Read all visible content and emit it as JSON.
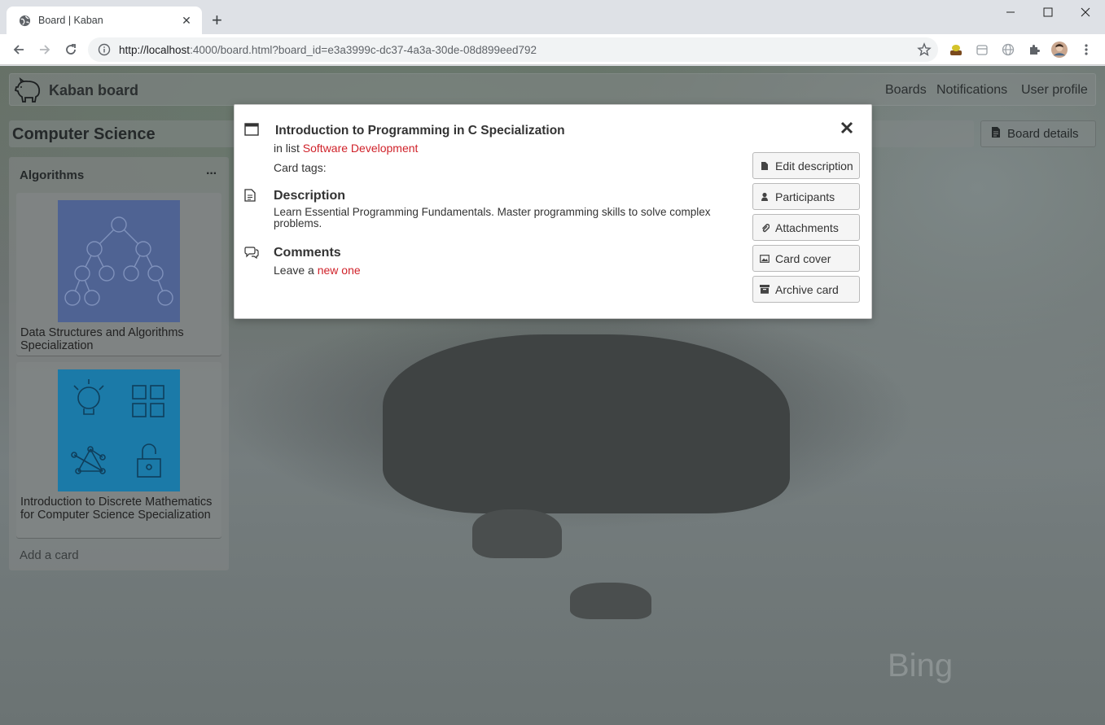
{
  "browser": {
    "tab_title": "Board | Kaban",
    "tab_close": "✕",
    "new_tab": "+",
    "url_host": "http://localhost",
    "url_rest": ":4000/board.html?board_id=e3a3999c-dc37-4a3a-30de-08d899eed792"
  },
  "app": {
    "brand": "Kaban board",
    "nav": [
      "Boards",
      "Notifications",
      "User profile"
    ],
    "board_title": "Computer Science",
    "board_details_label": "Board details"
  },
  "list": {
    "title": "Algorithms",
    "menu": "···",
    "cards": [
      {
        "title": "Data Structures and Algorithms Specialization",
        "cover": "tree-cover-icon",
        "cover_color": "#5a78b2"
      },
      {
        "title": "Introduction to Discrete Mathematics for Computer Science Specialization",
        "cover": "discrete-math-cover-icon",
        "cover_color": "#1e8fc6"
      }
    ],
    "add_card": "Add a card"
  },
  "modal": {
    "title": "Introduction to Programming in C Specialization",
    "in_list_prefix": "in list ",
    "list_name": "Software Development",
    "card_tags": "Card tags:",
    "description_heading": "Description",
    "description_text": "Learn Essential Programming Fundamentals. Master programming skills to solve complex problems.",
    "comments_heading": "Comments",
    "leave_prefix": "Leave a ",
    "leave_link": "new one",
    "buttons": [
      {
        "label": "Edit description",
        "icon": "file-icon"
      },
      {
        "label": "Participants",
        "icon": "user-icon"
      },
      {
        "label": "Attachments",
        "icon": "paperclip-icon"
      },
      {
        "label": "Card cover",
        "icon": "image-icon"
      },
      {
        "label": "Archive card",
        "icon": "archive-icon"
      }
    ]
  },
  "background_watermark": "Bing",
  "colors": {
    "link": "#d0222a",
    "overlay": "#6d7372"
  }
}
